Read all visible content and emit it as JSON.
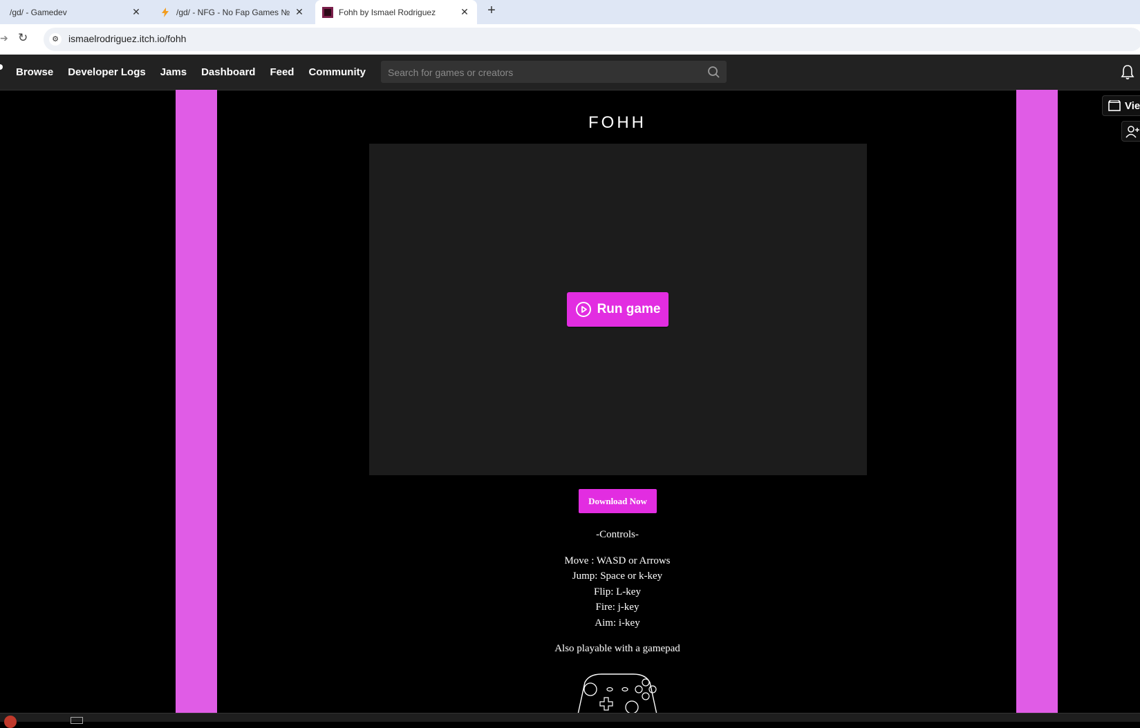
{
  "browser": {
    "tabs": [
      {
        "title": "/gd/ - Gamedev",
        "active": false,
        "icon": "site-favicon"
      },
      {
        "title": "/gd/ - NFG - No Fap Games №",
        "active": false,
        "icon": "lightning-favicon"
      },
      {
        "title": "Fohh by Ismael Rodriguez",
        "active": true,
        "icon": "game-favicon"
      }
    ],
    "new_tab_label": "+",
    "url": "ismaelrodriguez.itch.io/fohh"
  },
  "nav": {
    "links": [
      "Browse",
      "Developer Logs",
      "Jams",
      "Dashboard",
      "Feed",
      "Community"
    ],
    "search_placeholder": "Search for games or creators"
  },
  "sidebar": {
    "view_all_label": "Vie"
  },
  "game": {
    "title": "FOHH",
    "run_button_label": "Run game",
    "download_label": "Download Now",
    "controls_heading": "-Controls-",
    "controls": [
      "Move : WASD or Arrows",
      "Jump: Space or k-key",
      "Flip: L-key",
      "Fire: j-key",
      "Aim: i-key"
    ],
    "gamepad_note": "Also playable with a gamepad"
  },
  "colors": {
    "accent": "#e22de1",
    "deco_pink": "#e05ce6",
    "deco_teal": "#0b9a9a",
    "page_bg": "#000000",
    "frame_bg": "#1c1c1c",
    "nav_bg": "#222222"
  }
}
